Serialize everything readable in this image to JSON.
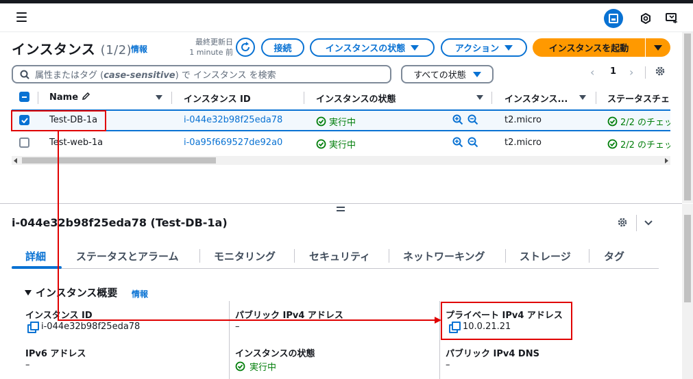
{
  "colors": {
    "accent": "#0972d3",
    "primary_button": "#ff9900",
    "success": "#037f0c",
    "annotation": "#e00000"
  },
  "header": {
    "title": "インスタンス",
    "count": "(1/2)",
    "info": "情報",
    "last_updated_label": "最終更新日",
    "last_updated_value": "1 minute 前",
    "connect_label": "接続",
    "instance_state_label": "インスタンスの状態",
    "actions_label": "アクション",
    "launch_label": "インスタンスを起動"
  },
  "filter": {
    "search_placeholder_prefix": "属性またはタグ (",
    "search_placeholder_em": "case-sensitive",
    "search_placeholder_suffix": ") で インスタンス を検索",
    "state_filter_label": "すべての状態",
    "page_number": "1"
  },
  "table": {
    "columns": [
      "Name",
      "インスタンス ID",
      "インスタンスの状態",
      "インスタンス...",
      "ステータスチェ"
    ],
    "rows": [
      {
        "name": "Test-DB-1a",
        "instance_id": "i-044e32b98f25eda78",
        "state": "実行中",
        "type": "t2.micro",
        "status": "2/2 のチェッ",
        "selected": true
      },
      {
        "name": "Test-web-1a",
        "instance_id": "i-0a95f669527de92a0",
        "state": "実行中",
        "type": "t2.micro",
        "status": "2/2 のチェッ",
        "selected": false
      }
    ]
  },
  "detail": {
    "title": "i-044e32b98f25eda78 (Test-DB-1a)",
    "tabs": [
      "詳細",
      "ステータスとアラーム",
      "モニタリング",
      "セキュリティ",
      "ネットワーキング",
      "ストレージ",
      "タグ"
    ],
    "section_title": "インスタンス概要",
    "section_info": "情報",
    "fields": {
      "instance_id_label": "インスタンス ID",
      "instance_id_value": "i-044e32b98f25eda78",
      "public_ipv4_label": "パブリック IPv4 アドレス",
      "public_ipv4_value": "–",
      "private_ipv4_label": "プライベート IPv4 アドレス",
      "private_ipv4_value": "10.0.21.21",
      "ipv6_label": "IPv6 アドレス",
      "ipv6_value": "–",
      "state_label": "インスタンスの状態",
      "state_value": "実行中",
      "public_dns_label": "パブリック IPv4 DNS",
      "public_dns_value": "–"
    }
  },
  "icons": [
    "menu-icon",
    "cloudshell-icon",
    "settings-hex-icon",
    "feedback-icon",
    "refresh-icon",
    "search-icon",
    "gear-icon",
    "edit-icon",
    "check-circle-icon",
    "zoom-in-icon",
    "zoom-out-icon",
    "copy-icon",
    "chevron-down-icon"
  ]
}
